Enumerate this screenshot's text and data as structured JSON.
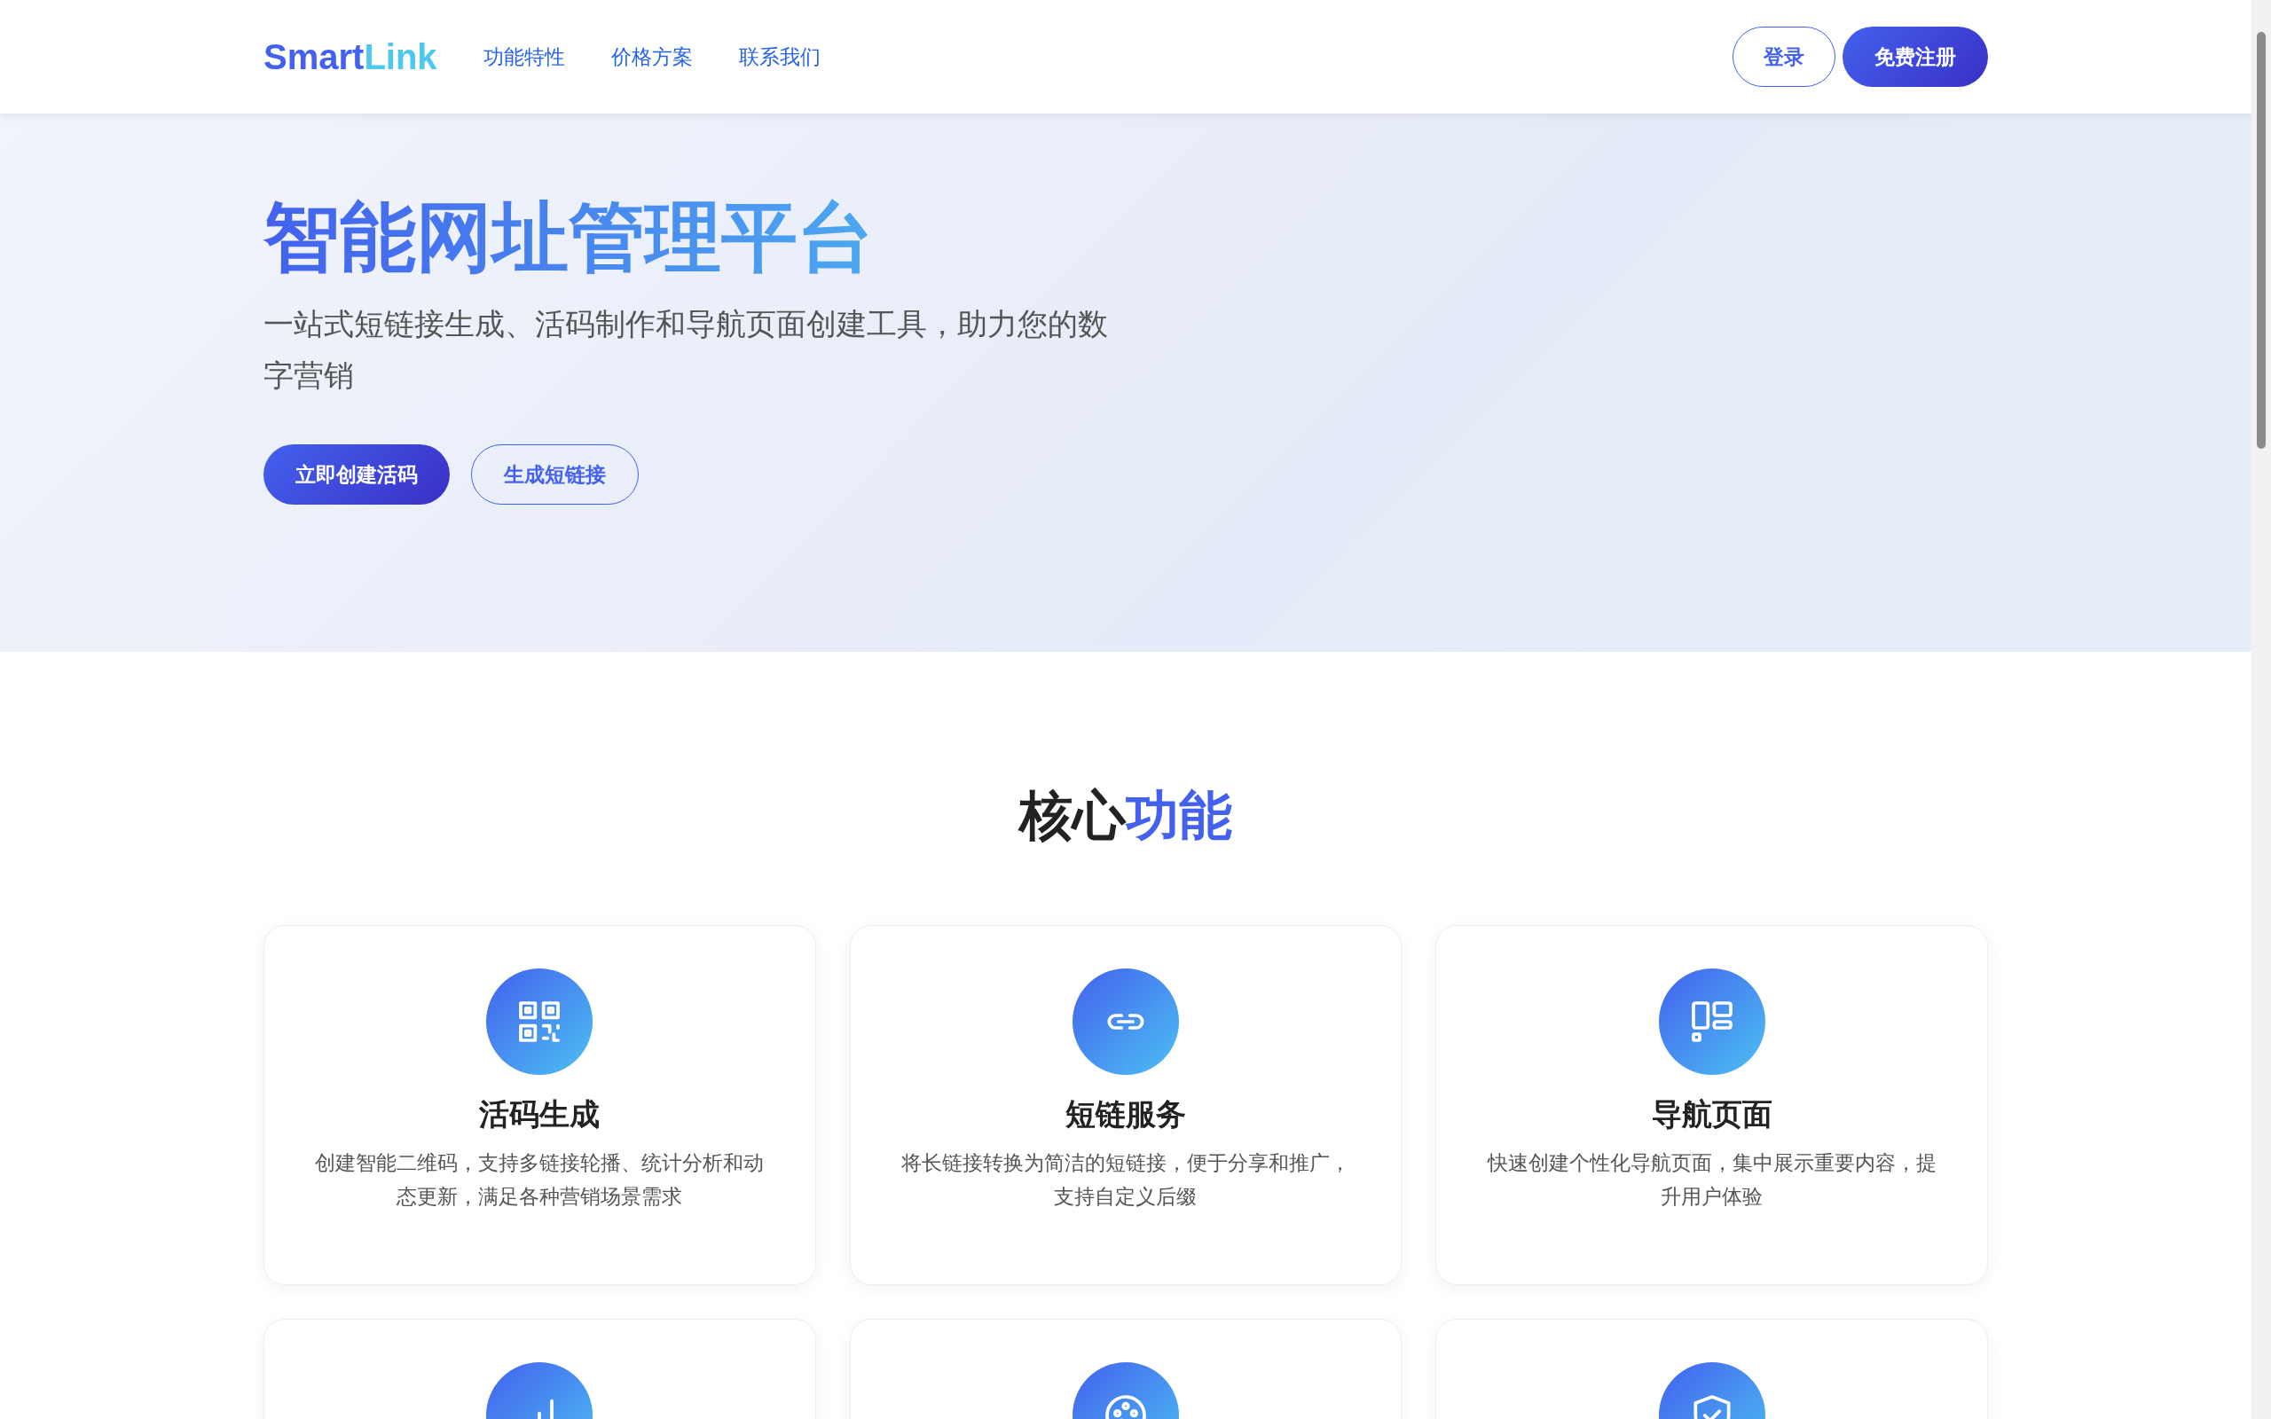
{
  "navbar": {
    "brand": [
      "Smart",
      "Link"
    ],
    "links": [
      "功能特性",
      "价格方案",
      "联系我们"
    ],
    "buttons": [
      {
        "kind": "outline",
        "label": "登录"
      },
      {
        "kind": "solid",
        "label": "免费注册"
      }
    ]
  },
  "hero": {
    "title": "智能网址管理平台",
    "subtitle": "一站式短链接生成、活码制作和导航页面创建工具，助力您的数字营销",
    "buttons": [
      {
        "kind": "solid",
        "label": "立即创建活码"
      },
      {
        "kind": "outline",
        "label": "生成短链接"
      }
    ]
  },
  "features": {
    "title": [
      "核心",
      "功能"
    ],
    "cards": [
      {
        "kind": "qr",
        "title": "活码生成",
        "description": "创建智能二维码，支持多链接轮播、统计分析和动态更新，满足各种营销场景需求"
      },
      {
        "kind": "link",
        "title": "短链服务",
        "description": "将长链接转换为简洁的短链接，便于分享和推广，支持自定义后缀"
      },
      {
        "kind": "layout",
        "title": "导航页面",
        "description": "快速创建个性化导航页面，集中展示重要内容，提升用户体验"
      },
      {
        "kind": "chart"
      },
      {
        "kind": "palette"
      },
      {
        "kind": "shield"
      }
    ]
  }
}
